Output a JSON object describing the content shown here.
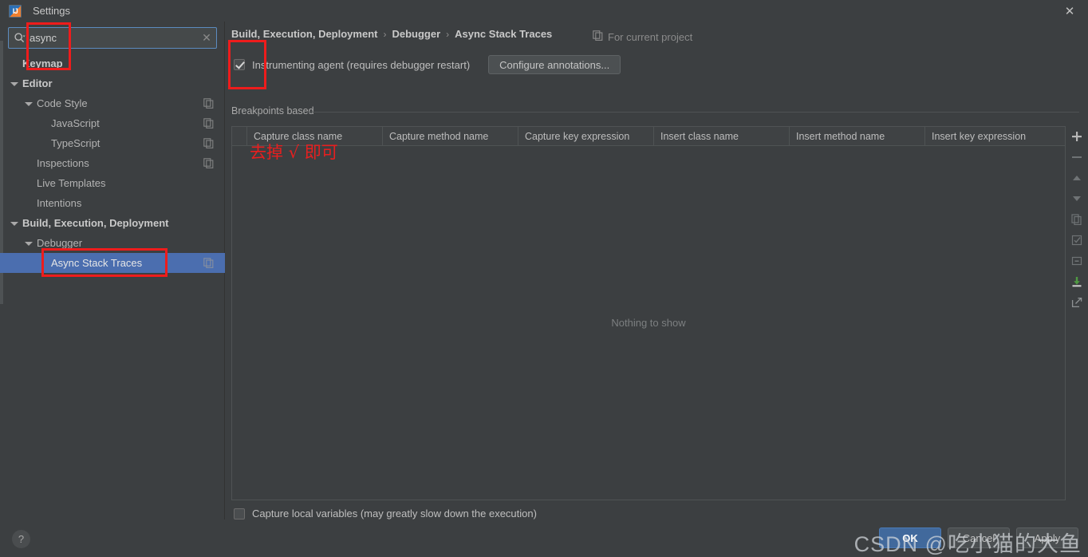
{
  "window": {
    "title": "Settings",
    "logo_icon": "intellij-idea-logo",
    "close_icon": "close-icon"
  },
  "search": {
    "value": "async",
    "placeholder": "",
    "icon": "search-icon",
    "clear_icon": "clear-icon"
  },
  "sidebar": {
    "items": [
      {
        "label": "Keymap",
        "indent": 0,
        "bold": true,
        "twisty": false,
        "badge": false,
        "selected": false
      },
      {
        "label": "Editor",
        "indent": 0,
        "bold": true,
        "twisty": true,
        "badge": false,
        "selected": false
      },
      {
        "label": "Code Style",
        "indent": 1,
        "bold": false,
        "twisty": true,
        "badge": true,
        "selected": false
      },
      {
        "label": "JavaScript",
        "indent": 2,
        "bold": false,
        "twisty": false,
        "badge": true,
        "selected": false
      },
      {
        "label": "TypeScript",
        "indent": 2,
        "bold": false,
        "twisty": false,
        "badge": true,
        "selected": false
      },
      {
        "label": "Inspections",
        "indent": 1,
        "bold": false,
        "twisty": false,
        "badge": true,
        "selected": false
      },
      {
        "label": "Live Templates",
        "indent": 1,
        "bold": false,
        "twisty": false,
        "badge": false,
        "selected": false
      },
      {
        "label": "Intentions",
        "indent": 1,
        "bold": false,
        "twisty": false,
        "badge": false,
        "selected": false
      },
      {
        "label": "Build, Execution, Deployment",
        "indent": 0,
        "bold": true,
        "twisty": true,
        "badge": false,
        "selected": false
      },
      {
        "label": "Debugger",
        "indent": 1,
        "bold": false,
        "twisty": true,
        "badge": false,
        "selected": false
      },
      {
        "label": "Async Stack Traces",
        "indent": 2,
        "bold": false,
        "twisty": false,
        "badge": true,
        "selected": true
      }
    ]
  },
  "content": {
    "breadcrumb": [
      "Build, Execution, Deployment",
      "Debugger",
      "Async Stack Traces"
    ],
    "breadcrumb_separator": "›",
    "for_current_project": "For current project",
    "for_current_project_icon": "copy-scope-icon",
    "instrumenting_agent": {
      "label": "Instrumenting agent (requires debugger restart)",
      "checked": true,
      "icon": "checkbox-checked-icon"
    },
    "configure_annotations_button": "Configure annotations...",
    "group_title": "Breakpoints based",
    "empty_message": "Nothing to show",
    "capture_local_variables": {
      "label": "Capture local variables (may greatly slow down the execution)",
      "checked": false,
      "icon": "checkbox-unchecked-icon"
    }
  },
  "table": {
    "columns": [
      "Capture class name",
      "Capture method name",
      "Capture key expression",
      "Insert class name",
      "Insert method name",
      "Insert key expression"
    ],
    "rows": []
  },
  "toolbar": {
    "buttons": [
      {
        "name": "add-button",
        "icon": "plus-icon",
        "enabled": true
      },
      {
        "name": "remove-button",
        "icon": "minus-icon",
        "enabled": false
      },
      {
        "name": "move-up-button",
        "icon": "arrow-up-icon",
        "enabled": false
      },
      {
        "name": "move-down-button",
        "icon": "arrow-down-icon",
        "enabled": false
      },
      {
        "name": "copy-button",
        "icon": "copy-icon",
        "enabled": false
      },
      {
        "name": "enable-all-button",
        "icon": "checkbox-list-icon",
        "enabled": false
      },
      {
        "name": "disable-all-button",
        "icon": "minus-box-icon",
        "enabled": false
      },
      {
        "name": "import-button",
        "icon": "import-download-icon",
        "enabled": true
      },
      {
        "name": "export-button",
        "icon": "export-arrow-icon",
        "enabled": true
      }
    ]
  },
  "footer": {
    "help_label": "?",
    "help_icon": "question-mark-icon",
    "buttons": [
      {
        "label": "OK",
        "style": "primary"
      },
      {
        "label": "Cancel",
        "style": "normal"
      },
      {
        "label": "Apply",
        "style": "normal"
      }
    ]
  },
  "annotations": {
    "note_text": "去掉 √ 即可"
  },
  "watermark": {
    "text": "CSDN @吃小猫的大鱼"
  },
  "colors": {
    "background": "#3c3f41",
    "selection": "#4b6eaf",
    "accent": "#41699c",
    "annotation": "#ee1c1c",
    "focus_border": "#5c8bbf"
  }
}
